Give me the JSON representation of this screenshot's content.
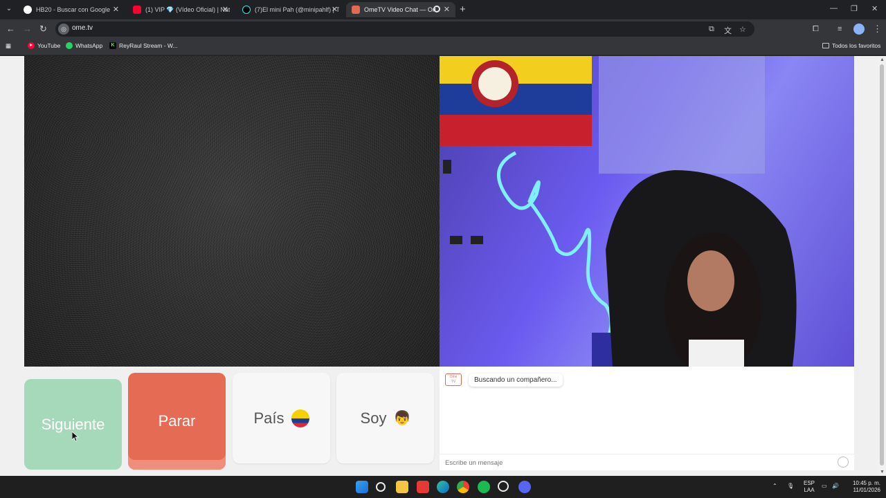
{
  "browser": {
    "tabs": [
      {
        "title": "HB20 - Buscar con Google",
        "active": false,
        "favicon": "google-icon"
      },
      {
        "title": "(1) VIP 💎 (Vídeo Oficial) | Nata",
        "active": false,
        "favicon": "youtube-icon"
      },
      {
        "title": "(7)El mini Pah (@minipahlf) | Ti",
        "active": false,
        "favicon": "tiktok-icon"
      },
      {
        "title": "OmeTV Video Chat — Ome",
        "active": true,
        "favicon": "ometv-icon"
      }
    ],
    "url": "ome.tv",
    "bookmarks": [
      {
        "label": "YouTube",
        "icon": "youtube-icon"
      },
      {
        "label": "WhatsApp",
        "icon": "whatsapp-icon"
      },
      {
        "label": "ReyRaul Stream - W...",
        "icon": "kick-icon"
      }
    ],
    "all_bookmarks_label": "Todos los favoritos"
  },
  "controls": {
    "next_label": "Siguiente",
    "stop_label": "Parar",
    "country_label": "País",
    "gender_label": "Soy",
    "country_flag": "colombia-flag",
    "gender_icon": "boy-face-icon"
  },
  "chat": {
    "status_message": "Buscando un compañero...",
    "input_placeholder": "Escribe un mensaje"
  },
  "taskbar": {
    "lang_top": "ESP",
    "lang_bottom": "LAA",
    "time": "10:45 p. m.",
    "date": "11/01/2026"
  },
  "colors": {
    "next_button": "#a6d9b9",
    "stop_button": "#e56b55",
    "chrome_dark": "#202124",
    "chrome_toolbar": "#35363a"
  }
}
